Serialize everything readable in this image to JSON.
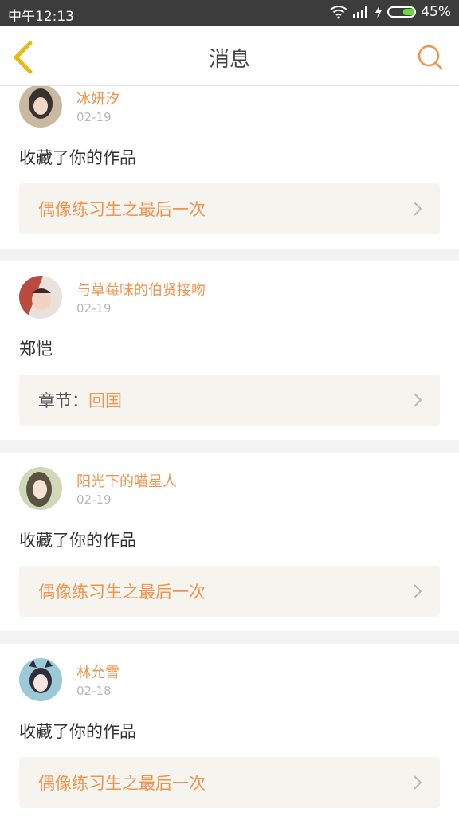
{
  "status_bar": {
    "time": "中午12:13",
    "battery": "45%"
  },
  "header": {
    "title": "消息"
  },
  "messages": [
    {
      "user": "冰妍汐",
      "date": "02-19",
      "text": "收藏了你的作品",
      "work_title": "偶像练习生之最后一次",
      "avatar_colors": [
        "#c9b9a2",
        "#3a3230"
      ]
    },
    {
      "user": "与草莓味的伯贤接吻",
      "date": "02-19",
      "text": "郑恺",
      "chapter_prefix": "章节：",
      "chapter_name": "回国",
      "avatar_colors": [
        "#b94a3e",
        "#e9e2dc"
      ]
    },
    {
      "user": "阳光下的喵星人",
      "date": "02-19",
      "text": "收藏了你的作品",
      "work_title": "偶像练习生之最后一次",
      "avatar_colors": [
        "#cfd8b8",
        "#5b5242"
      ]
    },
    {
      "user": "林允雪",
      "date": "02-18",
      "text": "收藏了你的作品",
      "work_title": "偶像练习生之最后一次",
      "avatar_colors": [
        "#9cc9d8",
        "#2c2f3a"
      ]
    }
  ],
  "colors": {
    "accent": "#f1924d",
    "back_arrow": "#e8b912",
    "status_bar": "#3c3c3c"
  }
}
